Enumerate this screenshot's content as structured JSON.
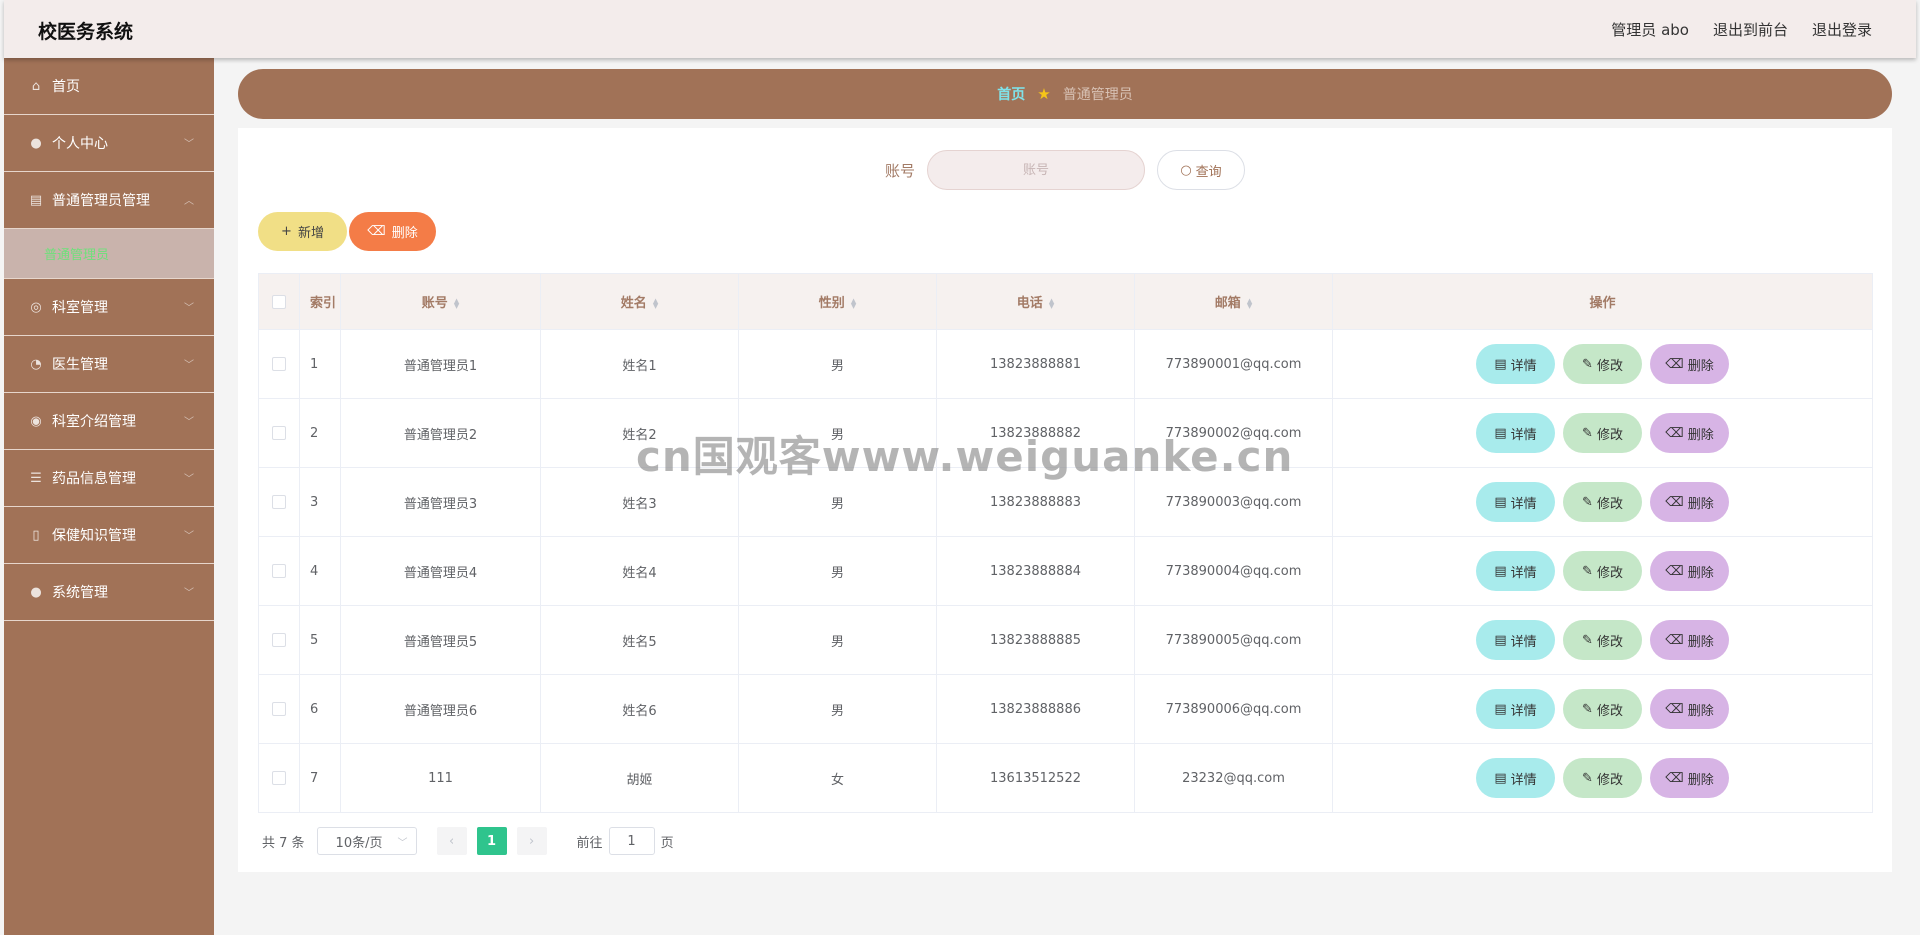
{
  "app": {
    "title": "校医务系统"
  },
  "topbar": {
    "admin": "管理员 abo",
    "to_front": "退出到前台",
    "logout": "退出登录"
  },
  "sidebar": {
    "items": [
      {
        "label": "首页",
        "icon": "home-icon"
      },
      {
        "label": "个人中心",
        "icon": "user-icon"
      },
      {
        "label": "普通管理员管理",
        "icon": "admin-icon",
        "expanded": true
      },
      {
        "label": "科室管理",
        "icon": "compass-icon"
      },
      {
        "label": "医生管理",
        "icon": "bell-icon"
      },
      {
        "label": "科室介绍管理",
        "icon": "target-icon"
      },
      {
        "label": "药品信息管理",
        "icon": "menu-icon"
      },
      {
        "label": "保健知识管理",
        "icon": "phone-icon"
      },
      {
        "label": "系统管理",
        "icon": "location-icon"
      }
    ],
    "sub_active": "普通管理员"
  },
  "breadcrumb": {
    "home": "首页",
    "current": "普通管理员"
  },
  "search": {
    "label": "账号",
    "placeholder": "账号",
    "button": "查询"
  },
  "actions": {
    "add": "新增",
    "delete": "删除"
  },
  "table": {
    "headers": {
      "index": "索引",
      "account": "账号",
      "name": "姓名",
      "gender": "性别",
      "phone": "电话",
      "email": "邮箱",
      "ops": "操作"
    },
    "rows": [
      {
        "index": "1",
        "account": "普通管理员1",
        "name": "姓名1",
        "gender": "男",
        "phone": "13823888881",
        "email": "773890001@qq.com"
      },
      {
        "index": "2",
        "account": "普通管理员2",
        "name": "姓名2",
        "gender": "男",
        "phone": "13823888882",
        "email": "773890002@qq.com"
      },
      {
        "index": "3",
        "account": "普通管理员3",
        "name": "姓名3",
        "gender": "男",
        "phone": "13823888883",
        "email": "773890003@qq.com"
      },
      {
        "index": "4",
        "account": "普通管理员4",
        "name": "姓名4",
        "gender": "男",
        "phone": "13823888884",
        "email": "773890004@qq.com"
      },
      {
        "index": "5",
        "account": "普通管理员5",
        "name": "姓名5",
        "gender": "男",
        "phone": "13823888885",
        "email": "773890005@qq.com"
      },
      {
        "index": "6",
        "account": "普通管理员6",
        "name": "姓名6",
        "gender": "男",
        "phone": "13823888886",
        "email": "773890006@qq.com"
      },
      {
        "index": "7",
        "account": "111",
        "name": "胡姬",
        "gender": "女",
        "phone": "13613512522",
        "email": "23232@qq.com"
      }
    ],
    "row_actions": {
      "detail": "详情",
      "edit": "修改",
      "delete": "删除"
    }
  },
  "pagination": {
    "total": "共 7 条",
    "page_size": "10条/页",
    "current_page": "1",
    "goto_label": "前往",
    "goto_value": "1",
    "page_suffix": "页"
  },
  "watermark": "cn国观客www.weiguanke.cn",
  "colors": {
    "sidebar": "#a17257",
    "accent_green": "#2fc48d",
    "add_button": "#f1df86",
    "delete_button": "#f47c47",
    "detail_button": "#a8ebec",
    "edit_button": "#c5e7c8",
    "row_delete_button": "#d7b4e5"
  }
}
